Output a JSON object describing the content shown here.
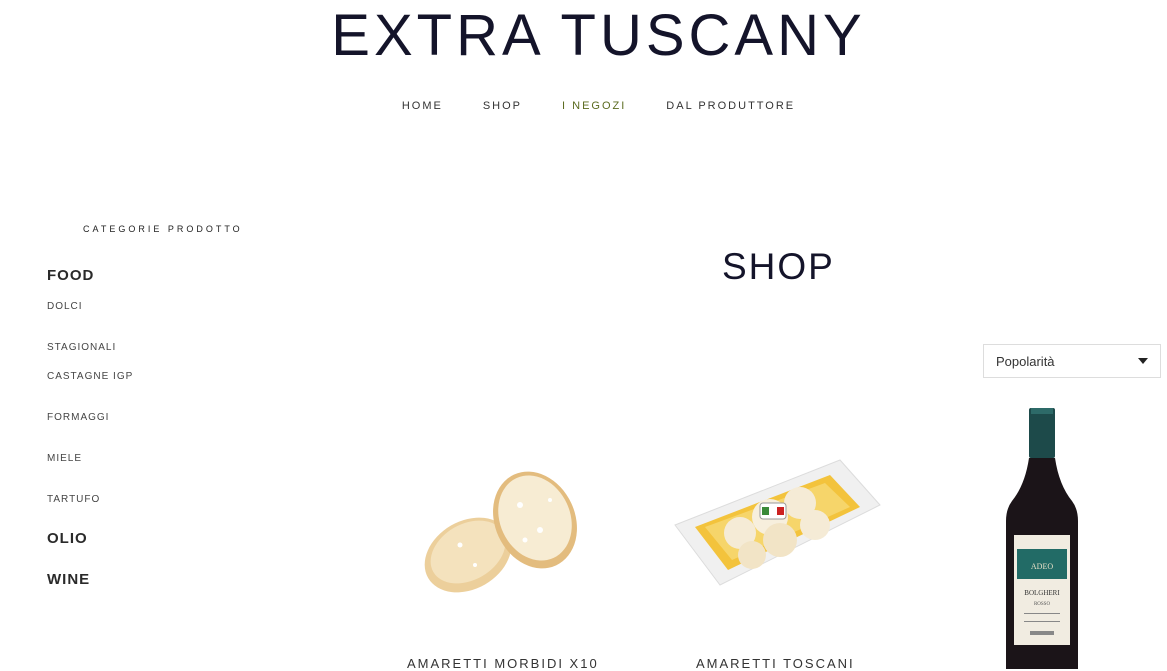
{
  "site": {
    "title": "EXTRA TUSCANY"
  },
  "nav": {
    "items": [
      "HOME",
      "SHOP",
      "I NEGOZI",
      "DAL PRODUTTORE"
    ],
    "active": "I NEGOZI",
    "active_color": "#5b6b1f"
  },
  "sidebar": {
    "heading": "CATEGORIE PRODOTTO",
    "items": [
      {
        "label": "FOOD",
        "level": "parent"
      },
      {
        "label": "DOLCI",
        "level": "child"
      },
      {
        "label": "STAGIONALI",
        "level": "child"
      },
      {
        "label": "CASTAGNE IGP",
        "level": "child"
      },
      {
        "label": "FORMAGGI",
        "level": "child"
      },
      {
        "label": "MIELE",
        "level": "child"
      },
      {
        "label": "TARTUFO",
        "level": "child"
      },
      {
        "label": "OLIO",
        "level": "parent"
      },
      {
        "label": "WINE",
        "level": "parent"
      }
    ]
  },
  "main": {
    "title": "SHOP",
    "sort": {
      "selected": "Popolarità",
      "icon": "caret-down-icon"
    }
  },
  "products": [
    {
      "name": "AMARETTI MORBIDI X10",
      "image": "amaretti-morbidi-image"
    },
    {
      "name": "AMARETTI TOSCANI",
      "image": "amaretti-toscani-image"
    },
    {
      "name": "",
      "image": "wine-bottle-image",
      "label_text": [
        "ADEO",
        "BOLGHERI",
        "ROSSO"
      ]
    }
  ],
  "colors": {
    "brand": "#14142a",
    "text": "#333333"
  }
}
